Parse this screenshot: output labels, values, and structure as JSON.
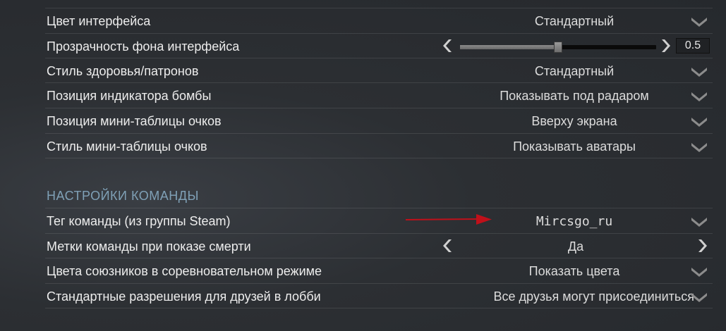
{
  "hud_settings": [
    {
      "label": "Цвет интерфейса",
      "value": "Стандартный"
    },
    {
      "label": "Прозрачность фона интерфейса",
      "slider_value": "0.5",
      "slider_fraction": 0.5
    },
    {
      "label": "Стиль здоровья/патронов",
      "value": "Стандартный"
    },
    {
      "label": "Позиция индикатора бомбы",
      "value": "Показывать под радаром"
    },
    {
      "label": "Позиция мини-таблицы очков",
      "value": "Вверху экрана"
    },
    {
      "label": "Стиль мини-таблицы очков",
      "value": "Показывать аватары"
    }
  ],
  "team_section": {
    "title": "НАСТРОЙКИ КОМАНДЫ",
    "rows": [
      {
        "label": "Тег команды (из группы Steam)",
        "value": "Mircsgo_ru"
      },
      {
        "label": "Метки команды при показе смерти",
        "value": "Да"
      },
      {
        "label": "Цвета союзников в соревновательном режиме",
        "value": "Показать цвета"
      },
      {
        "label": "Стандартные разрешения для друзей в лобби",
        "value": "Все друзья могут присоединиться"
      }
    ]
  },
  "icons": {
    "dropdown": "chevron-down-icon",
    "left": "chevron-left-icon",
    "right": "chevron-right-icon",
    "annotation": "red-arrow-icon"
  },
  "colors": {
    "section_title": "#7fa0b6",
    "annotation_arrow": "#c0101a"
  }
}
